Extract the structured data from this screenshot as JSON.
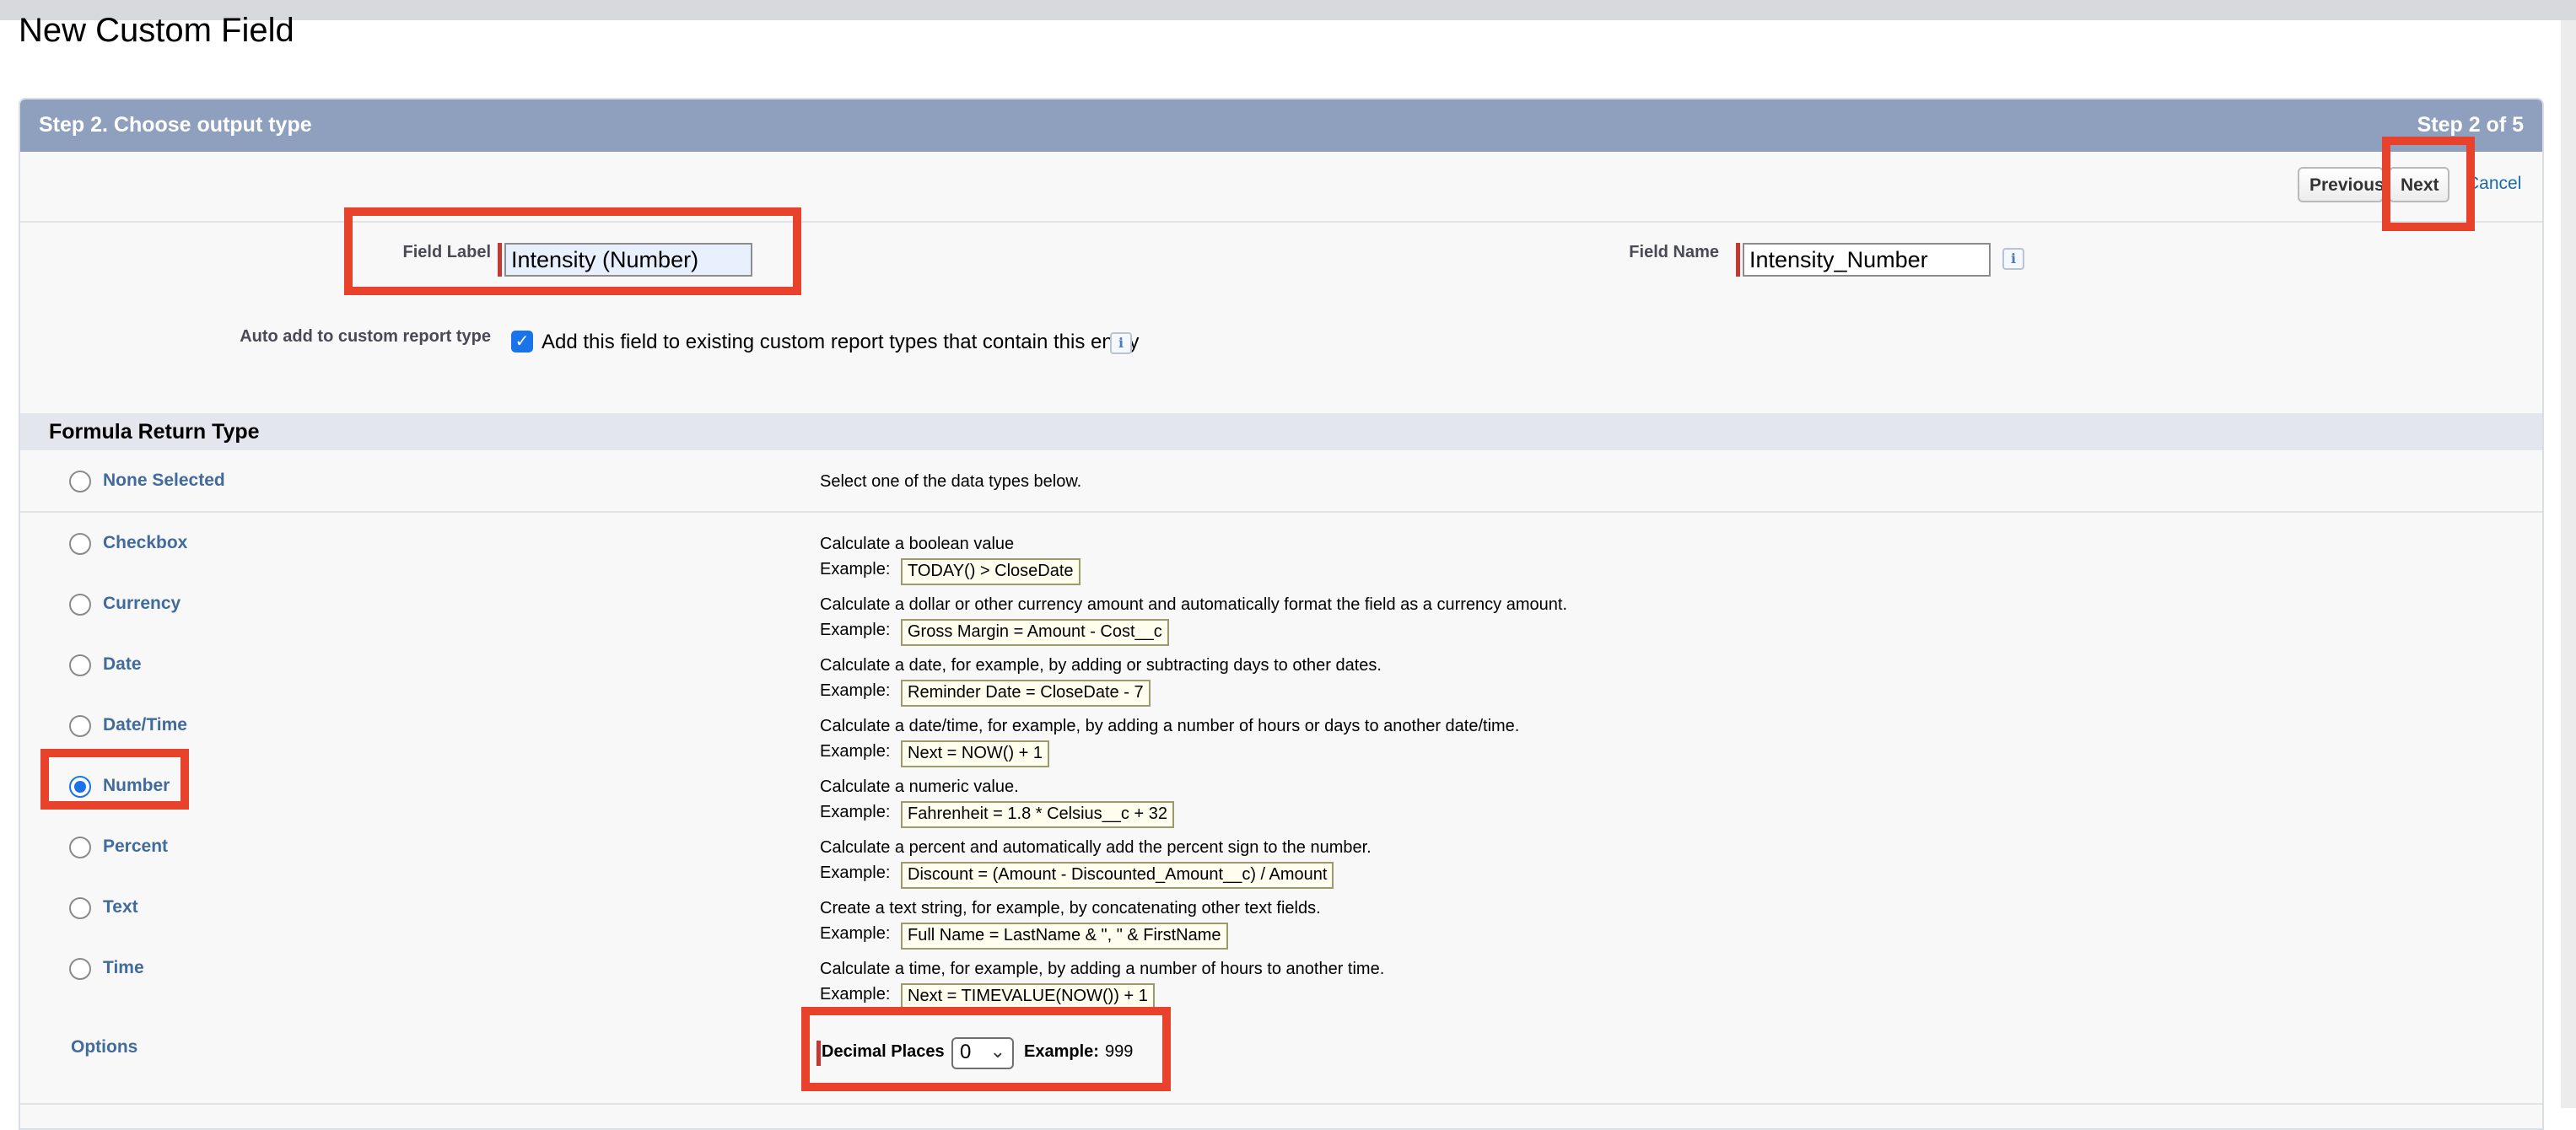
{
  "page": {
    "title": "New Custom Field"
  },
  "header": {
    "step_title": "Step 2. Choose output type",
    "step_count": "Step 2 of 5"
  },
  "toolbar": {
    "previous_label": "Previous",
    "next_label": "Next",
    "cancel_label": "Cancel"
  },
  "fields": {
    "field_label": {
      "label": "Field Label",
      "value": "Intensity (Number)"
    },
    "field_name": {
      "label": "Field Name",
      "value": "Intensity_Number"
    },
    "auto_add": {
      "label": "Auto add to custom report type",
      "text": "Add this field to existing custom report types that contain this entity",
      "checked": true
    }
  },
  "formula": {
    "section_title": "Formula Return Type",
    "none": {
      "label": "None Selected",
      "desc": "Select one of the data types below."
    },
    "example_prefix": "Example:",
    "types": [
      {
        "label": "Checkbox",
        "desc": "Calculate a boolean value",
        "example": "TODAY() > CloseDate",
        "selected": false
      },
      {
        "label": "Currency",
        "desc": "Calculate a dollar or other currency amount and automatically format the field as a currency amount.",
        "example": "Gross Margin = Amount - Cost__c",
        "selected": false
      },
      {
        "label": "Date",
        "desc": "Calculate a date, for example, by adding or subtracting days to other dates.",
        "example": "Reminder Date = CloseDate - 7",
        "selected": false
      },
      {
        "label": "Date/Time",
        "desc": "Calculate a date/time, for example, by adding a number of hours or days to another date/time.",
        "example": "Next = NOW() + 1",
        "selected": false
      },
      {
        "label": "Number",
        "desc": "Calculate a numeric value.",
        "example": "Fahrenheit = 1.8 * Celsius__c + 32",
        "selected": true
      },
      {
        "label": "Percent",
        "desc": "Calculate a percent and automatically add the percent sign to the number.",
        "example": "Discount = (Amount - Discounted_Amount__c) / Amount",
        "selected": false
      },
      {
        "label": "Text",
        "desc": "Create a text string, for example, by concatenating other text fields.",
        "example": "Full Name = LastName & \", \" & FirstName",
        "selected": false
      },
      {
        "label": "Time",
        "desc": "Calculate a time, for example, by adding a number of hours to another time.",
        "example": "Next = TIMEVALUE(NOW()) + 1",
        "selected": false
      }
    ]
  },
  "options": {
    "label": "Options",
    "decimal_places_label": "Decimal Places",
    "decimal_places_value": "0",
    "example_label": "Example:",
    "example_value": "999"
  },
  "icons": {
    "info": "info-icon",
    "check": "checkmark-icon",
    "dropdown": "chevron-down-icon"
  },
  "colors": {
    "header_bg": "#8ea0bd",
    "link": "#416b9c",
    "highlight": "#e8412c",
    "required": "#c23934",
    "accent": "#1a73e8"
  }
}
